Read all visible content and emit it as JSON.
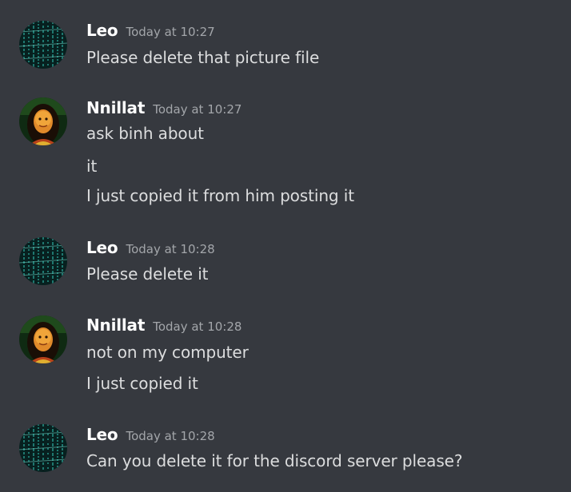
{
  "messages": [
    {
      "author": "Leo",
      "avatar": "matrix-code-avatar-icon",
      "timestamp": "Today at 10:27",
      "lines": [
        "Please delete that picture file"
      ]
    },
    {
      "author": "Nnillat",
      "avatar": "mona-lisa-avatar-icon",
      "timestamp": "Today at 10:27",
      "lines": [
        "ask binh about",
        "it",
        "I just copied it from him posting it"
      ]
    },
    {
      "author": "Leo",
      "avatar": "matrix-code-avatar-icon",
      "timestamp": "Today at 10:28",
      "lines": [
        "Please delete it"
      ]
    },
    {
      "author": "Nnillat",
      "avatar": "mona-lisa-avatar-icon",
      "timestamp": "Today at 10:28",
      "lines": [
        "not on my computer",
        "I just copied it"
      ]
    },
    {
      "author": "Leo",
      "avatar": "matrix-code-avatar-icon",
      "timestamp": "Today at 10:28",
      "lines": [
        "Can you delete it for the discord server please?"
      ]
    }
  ],
  "colors": {
    "background": "#36393f",
    "username": "#ffffff",
    "timestamp": "#a3a6aa",
    "message_text": "#dcddde"
  }
}
